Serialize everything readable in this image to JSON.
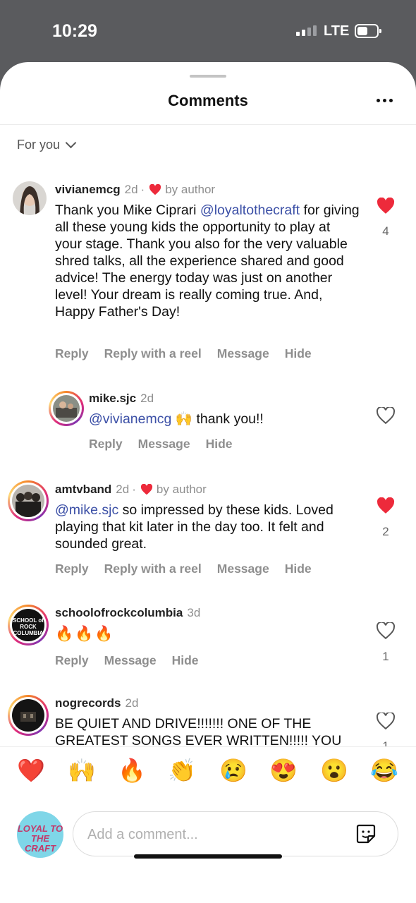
{
  "status_bar": {
    "time": "10:29",
    "network": "LTE"
  },
  "header": {
    "title": "Comments",
    "more_icon": "more-horizontal-icon"
  },
  "filter": {
    "label": "For you"
  },
  "comments": [
    {
      "username": "vivianemcg",
      "age": "2d",
      "liked_by_author": true,
      "author_tag": "by author",
      "text_parts": [
        "Thank you Mike Ciprari ",
        "@loyaltothecraft",
        " for giving all these young kids the opportunity to play at your stage. Thank you also for the very valuable shred talks, all the experience shared and good advice! The energy today was just on another level! Your dream is really coming true. And, Happy Father's Day!"
      ],
      "actions": [
        "Reply",
        "Reply with a reel",
        "Message",
        "Hide"
      ],
      "liked": true,
      "like_count": "4"
    },
    {
      "username": "mike.sjc",
      "age": "2d",
      "text_parts": [
        "@vivianemcg",
        " 🙌 thank you!!"
      ],
      "actions": [
        "Reply",
        "Message",
        "Hide"
      ],
      "liked": false,
      "like_count": ""
    },
    {
      "username": "amtvband",
      "age": "2d",
      "liked_by_author": true,
      "author_tag": "by author",
      "text_parts": [
        "@mike.sjc",
        " so impressed by these kids. Loved playing that kit later in the day too. It felt and sounded great."
      ],
      "actions": [
        "Reply",
        "Reply with a reel",
        "Message",
        "Hide"
      ],
      "liked": true,
      "like_count": "2"
    },
    {
      "username": "schoolofrockcolumbia",
      "age": "3d",
      "text_parts": [
        "🔥🔥🔥"
      ],
      "actions": [
        "Reply",
        "Message",
        "Hide"
      ],
      "liked": false,
      "like_count": "1",
      "avatar_text": "SCHOOL of ROCK COLUMBIA"
    },
    {
      "username": "nogrecords",
      "age": "2d",
      "text_parts": [
        "BE QUIET AND DRIVE!!!!!!! ONE OF THE GREATEST SONGS EVER WRITTEN!!!!! YOU"
      ],
      "liked": false,
      "like_count": "1"
    }
  ],
  "emoji_bar": [
    "❤️",
    "🙌",
    "🔥",
    "👏",
    "😢",
    "😍",
    "😮",
    "😂"
  ],
  "composer": {
    "placeholder": "Add a comment...",
    "avatar_text": "LOYAL TO THE CRAFT",
    "sticker_icon": "sticker-icon"
  },
  "colors": {
    "like_red": "#ed2a3b",
    "mention_blue": "#3b4fa6",
    "meta_gray": "#8e8e8e"
  }
}
